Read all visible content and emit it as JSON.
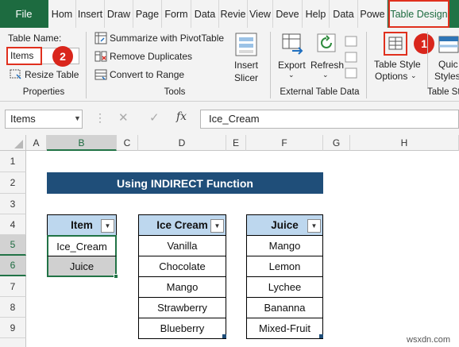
{
  "ribbon_tabs": {
    "file": "File",
    "home": "Hom",
    "insert": "Insert",
    "draw": "Draw",
    "page": "Page",
    "form": "Form",
    "data": "Data",
    "review": "Revie",
    "view": "View",
    "developer": "Deve",
    "help": "Help",
    "data2": "Data",
    "power": "Powe",
    "table_design": "Table Design"
  },
  "properties": {
    "table_name_label": "Table Name:",
    "table_name_value": "Items",
    "resize_table": "Resize Table",
    "group_label": "Properties"
  },
  "tools": {
    "summarize": "Summarize with PivotTable",
    "remove_duplicates": "Remove Duplicates",
    "convert_to_range": "Convert to Range",
    "insert_slicer_1": "Insert",
    "insert_slicer_2": "Slicer",
    "group_label": "Tools"
  },
  "external": {
    "export": "Export",
    "refresh": "Refresh",
    "group_label": "External Table Data"
  },
  "style_options": {
    "line1": "Table Style",
    "line2": "Options",
    "quick_1": "Quic",
    "quick_2": "Styles",
    "group_label": "Table St"
  },
  "callouts": {
    "one": "1",
    "two": "2"
  },
  "formula_bar": {
    "name_box": "Items",
    "fx": "fx",
    "formula": "Ice_Cream"
  },
  "columns": [
    "A",
    "B",
    "C",
    "D",
    "E",
    "F",
    "G",
    "H"
  ],
  "rows": [
    "1",
    "2",
    "3",
    "4",
    "5",
    "6",
    "7",
    "8",
    "9"
  ],
  "sheet": {
    "title": "Using INDIRECT Function",
    "items_table": {
      "header": "Item",
      "values": [
        "Ice_Cream",
        "Juice"
      ]
    },
    "icecream_table": {
      "header": "Ice Cream",
      "values": [
        "Vanilla",
        "Chocolate",
        "Mango",
        "Strawberry",
        "Blueberry"
      ]
    },
    "juice_table": {
      "header": "Juice",
      "values": [
        "Mango",
        "Lemon",
        "Lychee",
        "Bananna",
        "Mixed-Fruit"
      ]
    }
  },
  "watermark": "wsxdn.com",
  "colors": {
    "excel_green": "#217346",
    "title_fill": "#1f4e79",
    "table_header_fill": "#bdd7ee",
    "callout_red": "#d9261c"
  }
}
